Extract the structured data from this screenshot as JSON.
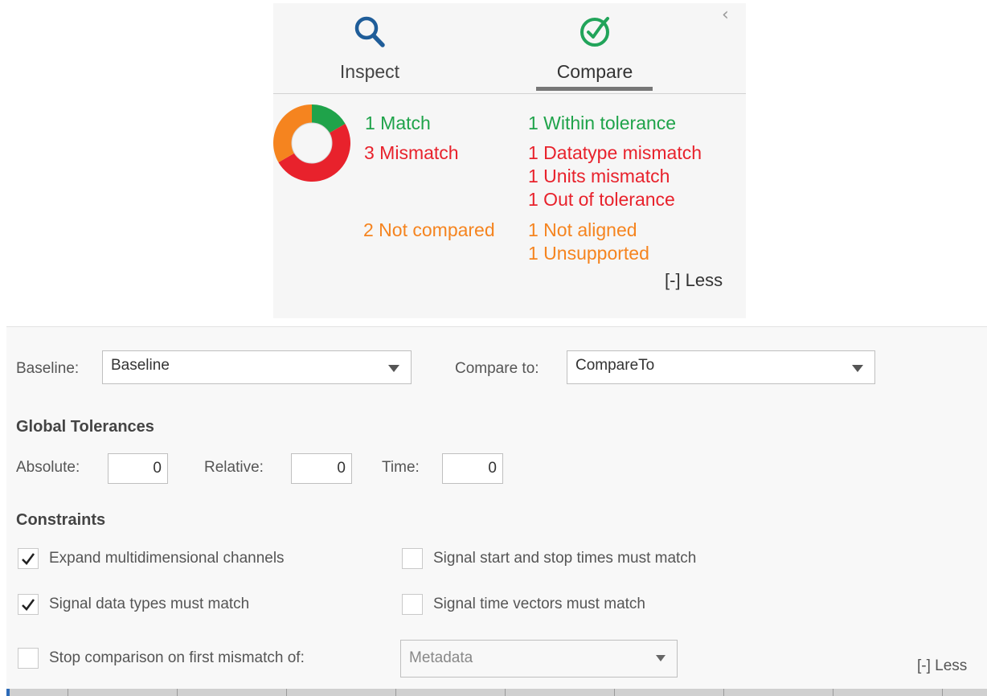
{
  "tabs": [
    {
      "label": "Inspect",
      "icon": "search-icon",
      "color": "#1f5d99"
    },
    {
      "label": "Compare",
      "icon": "check-circle-icon",
      "color": "#21a45a",
      "active": true
    }
  ],
  "collapse_chevron": "‹",
  "summary": {
    "match": "1 Match",
    "mismatch": "3 Mismatch",
    "not_compared": "2 Not compared",
    "within_tolerance": "1 Within tolerance",
    "datatype_mismatch": "1 Datatype mismatch",
    "units_mismatch": "1 Units mismatch",
    "out_of_tolerance": "1 Out of tolerance",
    "not_aligned": "1 Not aligned",
    "unsupported": "1 Unsupported",
    "less_label": "[-] Less",
    "chart": {
      "match": 1,
      "mismatch": 3,
      "not_compared": 2
    }
  },
  "colors": {
    "match": "#1fa34a",
    "mismatch": "#e8222c",
    "not_compared": "#f5841f"
  },
  "settings": {
    "baseline_label": "Baseline:",
    "baseline_value": "Baseline",
    "compare_to_label": "Compare to:",
    "compare_to_value": "CompareTo",
    "global_tolerances_heading": "Global Tolerances",
    "absolute_label": "Absolute:",
    "absolute_value": "0",
    "relative_label": "Relative:",
    "relative_value": "0",
    "time_label": "Time:",
    "time_value": "0",
    "constraints_heading": "Constraints",
    "constraints": [
      {
        "label": "Expand multidimensional channels",
        "checked": true
      },
      {
        "label": "Signal start and stop times must match",
        "checked": false
      },
      {
        "label": "Signal data types must match",
        "checked": true
      },
      {
        "label": "Signal time vectors must match",
        "checked": false
      },
      {
        "label": "Stop comparison on first mismatch of:",
        "checked": false
      }
    ],
    "stop_on_value": "Metadata",
    "less_label": "[-] Less"
  }
}
